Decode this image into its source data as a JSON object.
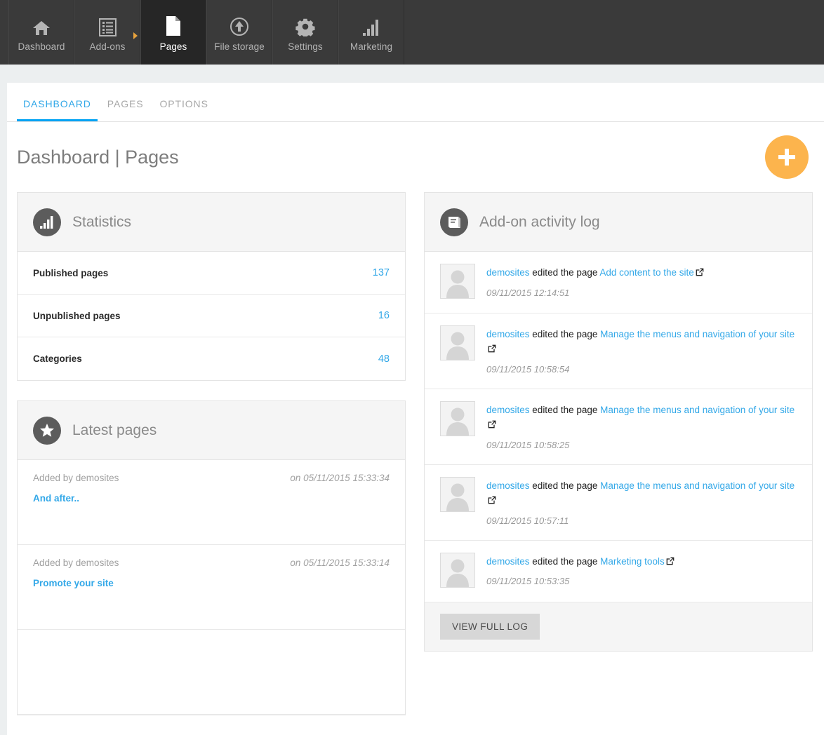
{
  "topnav": {
    "items": [
      {
        "label": "Dashboard",
        "icon": "home-icon",
        "active": false,
        "has_arrow": false
      },
      {
        "label": "Add-ons",
        "icon": "list-icon",
        "active": false,
        "has_arrow": true
      },
      {
        "label": "Pages",
        "icon": "page-icon",
        "active": true,
        "has_arrow": false
      },
      {
        "label": "File storage",
        "icon": "upload-icon",
        "active": false,
        "has_arrow": false
      },
      {
        "label": "Settings",
        "icon": "gear-icon",
        "active": false,
        "has_arrow": false
      },
      {
        "label": "Marketing",
        "icon": "bar-chart-icon",
        "active": false,
        "has_arrow": false
      }
    ]
  },
  "tabs": [
    {
      "label": "DASHBOARD",
      "active": true
    },
    {
      "label": "PAGES",
      "active": false
    },
    {
      "label": "OPTIONS",
      "active": false
    }
  ],
  "page": {
    "title": "Dashboard | Pages",
    "add_button_label": "+"
  },
  "statistics": {
    "title": "Statistics",
    "icon": "bar-chart-icon",
    "rows": [
      {
        "label": "Published pages",
        "value": "137"
      },
      {
        "label": "Unpublished pages",
        "value": "16"
      },
      {
        "label": "Categories",
        "value": "48"
      }
    ]
  },
  "latest_pages": {
    "title": "Latest pages",
    "icon": "star-icon",
    "rows": [
      {
        "added_by": "Added by demosites",
        "when": "on 05/11/2015 15:33:34",
        "name": "And after.."
      },
      {
        "added_by": "Added by demosites",
        "when": "on 05/11/2015 15:33:14",
        "name": "Promote your site"
      }
    ]
  },
  "activity_log": {
    "title": "Add-on activity log",
    "icon": "book-icon",
    "view_full_log_label": "VIEW FULL LOG",
    "entries": [
      {
        "user": "demosites",
        "action": "edited the page",
        "page": "Add content to the site",
        "time": "09/11/2015 12:14:51"
      },
      {
        "user": "demosites",
        "action": "edited the page",
        "page": "Manage the menus and navigation of your site",
        "time": "09/11/2015 10:58:54"
      },
      {
        "user": "demosites",
        "action": "edited the page",
        "page": "Manage the menus and navigation of your site",
        "time": "09/11/2015 10:58:25"
      },
      {
        "user": "demosites",
        "action": "edited the page",
        "page": "Manage the menus and navigation of your site",
        "time": "09/11/2015 10:57:11"
      },
      {
        "user": "demosites",
        "action": "edited the page",
        "page": "Marketing tools",
        "time": "09/11/2015 10:53:35"
      }
    ]
  },
  "colors": {
    "nav_background": "#3a3a3a",
    "nav_active": "#262626",
    "accent_blue": "#33a8e8",
    "tab_underline": "#00a2f3",
    "fab_orange": "#fcb44d",
    "page_background": "#eceff0",
    "panel_header": "#f5f5f5"
  }
}
